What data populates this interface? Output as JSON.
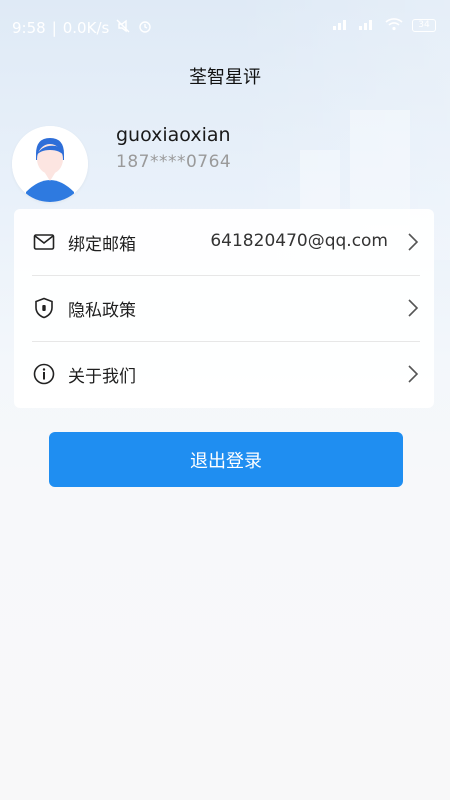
{
  "status_bar": {
    "time": "9:58",
    "network_speed": "0.0K/s",
    "battery": "34"
  },
  "header": {
    "title": "荃智星评"
  },
  "profile": {
    "username": "guoxiaoxian",
    "phone": "187****0764"
  },
  "menu": {
    "items": [
      {
        "label": "绑定邮箱",
        "value": "641820470@qq.com",
        "icon": "mail-icon"
      },
      {
        "label": "隐私政策",
        "value": "",
        "icon": "shield-icon"
      },
      {
        "label": "关于我们",
        "value": "",
        "icon": "info-icon"
      }
    ]
  },
  "logout": {
    "label": "退出登录"
  },
  "colors": {
    "accent": "#1f8ef1"
  }
}
